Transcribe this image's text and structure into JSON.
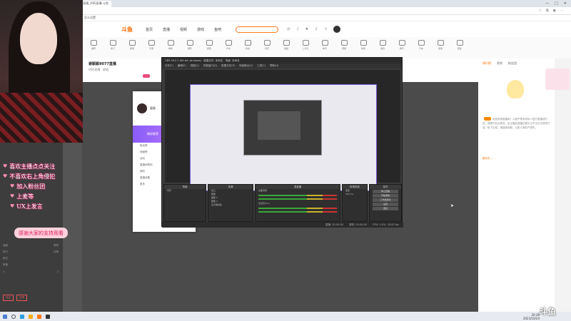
{
  "browser": {
    "tabs": [
      {
        "label": "斗鱼平台"
      },
      {
        "label": "找不到斗鱼直播 - 斗鱼"
      },
      {
        "label": "谢颖颖9077直播_OBS直播-斗鱼",
        "active": true
      }
    ],
    "window_controls": [
      "—",
      "□",
      "✕"
    ],
    "url": "https://www.douyu.com/9077",
    "bookmark": "怎么设置"
  },
  "site": {
    "logo": "斗鱼",
    "nav": [
      "首页",
      "直播",
      "视频",
      "游戏",
      "鱼吧"
    ],
    "header_icons": [
      "history-icon",
      "bell-icon",
      "star-icon",
      "download-icon",
      "upload-icon"
    ],
    "categories": [
      "推荐",
      "热门",
      "网游",
      "手游",
      "单机",
      "娱乐",
      "颜值",
      "户外",
      "科技",
      "音乐",
      "舞蹈",
      "二次元",
      "体育",
      "赛事",
      "搞笑",
      "美食",
      "教育",
      "汽车",
      "旅游",
      "更多"
    ]
  },
  "room": {
    "title": "谢颖颖9077直播",
    "meta": "OBS直播 · 颜值",
    "chat_name": "颖颖",
    "chat_promo": "精彩推荐",
    "chat_rows": [
      "粉丝榜",
      "贡献榜",
      "活动",
      "直播间规则",
      "我的",
      "直播设置",
      "更多"
    ]
  },
  "obs": {
    "title": "OBS 28.0.1 (64-bit, windows) - 配置文件: 未命名 - 场景: 未命名",
    "menu": [
      "文件(F)",
      "编辑(E)",
      "视图(V)",
      "停靠窗口(D)",
      "配置文件(P)",
      "场景集合(S)",
      "工具(T)",
      "帮助(H)"
    ],
    "docks": {
      "scenes_title": "场景",
      "scenes": [
        "场景"
      ],
      "sources_title": "来源",
      "sources": [
        "窗口",
        "图像",
        "图像 2",
        "图像 3",
        "显示器采集"
      ],
      "mixer_title": "混音器",
      "mixer": [
        "桌面音频",
        "麦克风/Aux"
      ],
      "transitions_title": "转场特效",
      "transition": "渐变",
      "duration": "300 ms",
      "controls_title": "控件",
      "controls": [
        "停止直播",
        "开始录制",
        "工作室模式",
        "设置",
        "退出"
      ]
    },
    "status": [
      "直播: 00:00:00",
      "录制: 00:00:00",
      "CPU: 0.0%, 30.00 fps"
    ]
  },
  "overlay": {
    "lines": [
      "喜欢主播点点关注",
      "不喜欢右上角侵犯",
      "加入粉丝团",
      "上麦等",
      "UX上发言"
    ],
    "pill": "感谢大家的支持观看"
  },
  "left_panel": {
    "rows": [
      {
        "a": "贡献",
        "b": "周榜"
      },
      {
        "a": "排行",
        "b": "月榜"
      },
      {
        "a": "粉丝",
        "b": ""
      },
      {
        "a": "房管",
        "b": ""
      },
      {
        "a": "1",
        "b": "2"
      }
    ],
    "buttons": [
      "关注",
      "分享"
    ]
  },
  "right_panel": {
    "tabs": [
      "排行榜",
      "贵宾",
      "粉丝团"
    ],
    "text": "欢迎来到直播间！斗鱼严禁未成年人进行直播或打赏，请遵守社区规范。如主播在直播过程中以不当方式诱导打赏、私下交易，请谨慎判断，以防人身财产损失。",
    "line": "聊天中……"
  },
  "taskbar": {
    "time": "20:36",
    "date": "2023/10/24"
  },
  "watermark": "斗鱼"
}
